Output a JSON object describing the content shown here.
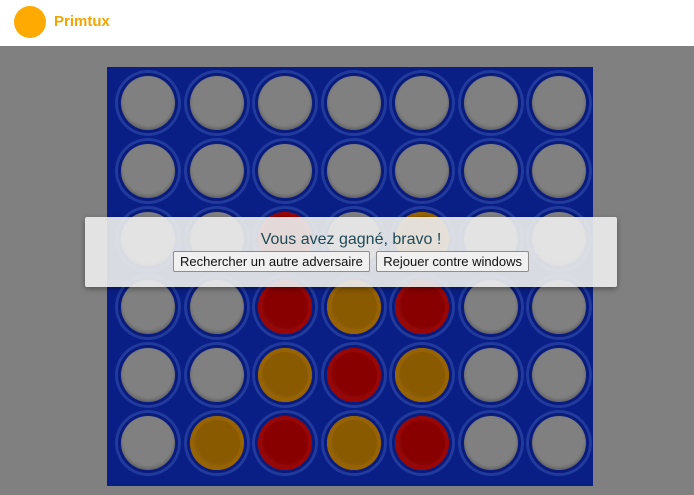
{
  "header": {
    "brand": "Primtux",
    "logo_color": "#ffaa00",
    "brand_color": "#f0a500"
  },
  "colors": {
    "board": "#0a1f86",
    "background": "#808080",
    "red": "#880000",
    "yellow": "#8a5a00"
  },
  "board": {
    "columns": 7,
    "rows": 6,
    "grid": [
      [
        "empty",
        "empty",
        "empty",
        "empty",
        "empty",
        "empty",
        "empty"
      ],
      [
        "empty",
        "empty",
        "empty",
        "empty",
        "empty",
        "empty",
        "empty"
      ],
      [
        "empty",
        "empty",
        "red",
        "empty",
        "yellow",
        "empty",
        "empty"
      ],
      [
        "empty",
        "empty",
        "red",
        "yellow",
        "red",
        "empty",
        "empty"
      ],
      [
        "empty",
        "empty",
        "yellow",
        "red",
        "yellow",
        "empty",
        "empty"
      ],
      [
        "empty",
        "yellow",
        "red",
        "yellow",
        "red",
        "empty",
        "empty"
      ]
    ]
  },
  "dialog": {
    "message": "Vous avez gagné, bravo !",
    "button_search": "Rechercher un autre adversaire",
    "button_replay": "Rejouer contre windows"
  }
}
